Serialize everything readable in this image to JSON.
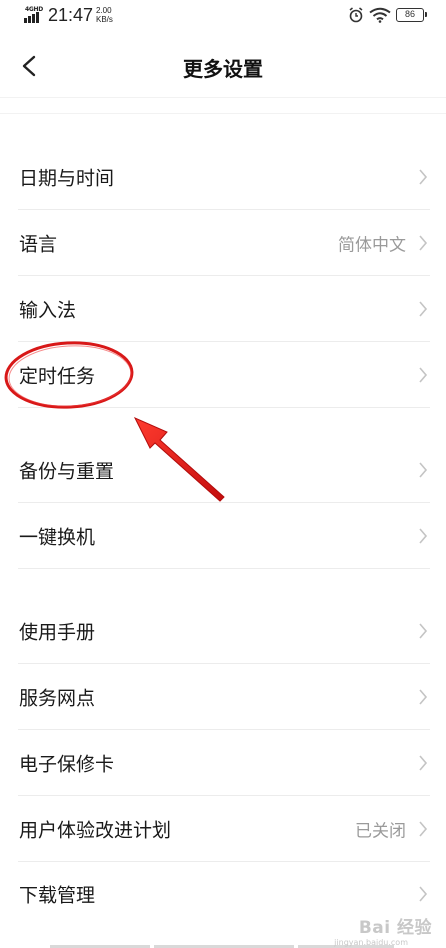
{
  "status_bar": {
    "network": "4GHD",
    "time": "21:47",
    "speed_value": "2.00",
    "speed_unit": "KB/s",
    "battery": "86"
  },
  "header": {
    "title": "更多设置"
  },
  "groups": [
    {
      "items": [
        {
          "label": "日期与时间",
          "value": ""
        },
        {
          "label": "语言",
          "value": "简体中文"
        },
        {
          "label": "输入法",
          "value": ""
        },
        {
          "label": "定时任务",
          "value": ""
        }
      ]
    },
    {
      "items": [
        {
          "label": "备份与重置",
          "value": ""
        },
        {
          "label": "一键换机",
          "value": ""
        }
      ]
    },
    {
      "items": [
        {
          "label": "使用手册",
          "value": ""
        },
        {
          "label": "服务网点",
          "value": ""
        },
        {
          "label": "电子保修卡",
          "value": ""
        },
        {
          "label": "用户体验改进计划",
          "value": "已关闭"
        },
        {
          "label": "下载管理",
          "value": ""
        }
      ]
    }
  ],
  "annotation": {
    "color": "#e02020"
  },
  "watermark": {
    "text": "Bai 经验",
    "sub": "jingyan.baidu.com"
  }
}
